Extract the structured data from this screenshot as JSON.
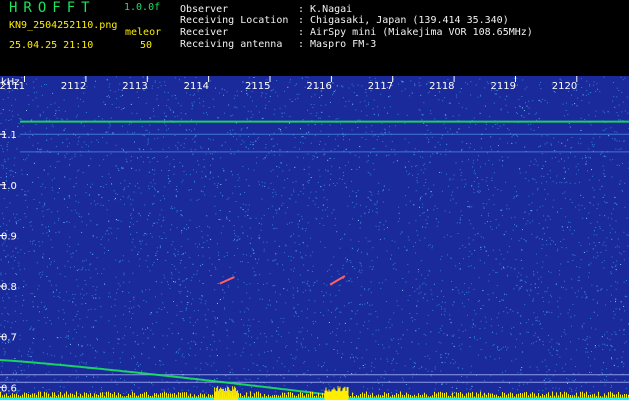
{
  "header": {
    "app_title": "HROFFT",
    "app_version": "1.0.0f",
    "file_name": "KN9_2504252110.png",
    "datetime": "25.04.25 21:10",
    "mode_label": "meleor",
    "mode_value": "50",
    "info": [
      {
        "label": "Observer",
        "value": ": K.Nagai"
      },
      {
        "label": "Receiving Location",
        "value": ": Chigasaki, Japan (139.414 35.340)"
      },
      {
        "label": "Receiver",
        "value": ": AirSpy mini (Miakejima VOR 108.65MHz)"
      },
      {
        "label": "Receiving antenna",
        "value": ": Maspro FM-3"
      }
    ]
  },
  "chart_data": {
    "type": "heatmap",
    "ylabel": "kHz",
    "x_ticks": [
      "2111",
      "2112",
      "2113",
      "2114",
      "2115",
      "2116",
      "2117",
      "2118",
      "2119",
      "2120"
    ],
    "y_ticks": [
      "1.1",
      "1.0",
      "0.9",
      "0.8",
      "0.7",
      "0.6"
    ],
    "ylim": [
      0.575,
      1.215
    ],
    "colors": {
      "background": "#1a2a9a",
      "noise": "#2f7fd8",
      "signal": "#19e35f",
      "peak": "#ffee00",
      "baseline": "#10f0ff"
    },
    "carrier_lines_khz": [
      1.125,
      1.1,
      1.065
    ],
    "events": [
      {
        "x_minute": 2114.3,
        "y_khz": [
          0.805,
          0.818
        ]
      },
      {
        "x_minute": 2116.1,
        "y_khz": [
          0.803,
          0.82
        ]
      }
    ]
  }
}
